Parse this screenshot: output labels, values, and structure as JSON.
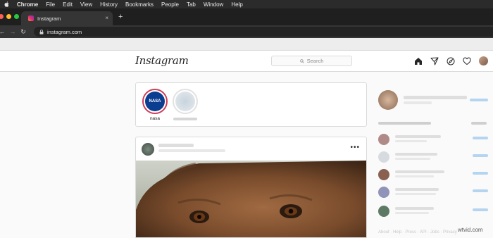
{
  "menubar": {
    "items": [
      "Chrome",
      "File",
      "Edit",
      "View",
      "History",
      "Bookmarks",
      "People",
      "Tab",
      "Window",
      "Help"
    ]
  },
  "browser": {
    "tab_title": "Instagram",
    "tab_close": "×",
    "new_tab": "+",
    "url": "instagram.com",
    "back": "←",
    "forward": "→",
    "reload": "↻",
    "traffic_colors": [
      "#ff5f57",
      "#febc2e",
      "#28c840"
    ]
  },
  "instagram": {
    "logo": "Instagram",
    "search_placeholder": "Search",
    "nav_icons": [
      "home-icon",
      "direct-icon",
      "explore-icon",
      "activity-heart-icon",
      "profile-avatar"
    ],
    "stories": [
      {
        "label": "nasa",
        "avatar": "NASA"
      }
    ],
    "post": {
      "more": "•••"
    }
  },
  "footer": {
    "text": "About · Help · Press · API · Jobs · Privacy"
  },
  "watermark": "wtvid.com",
  "colors": {
    "story_ring": "#d03d58",
    "border": "#dbdbdb",
    "background": "#fafafa"
  }
}
